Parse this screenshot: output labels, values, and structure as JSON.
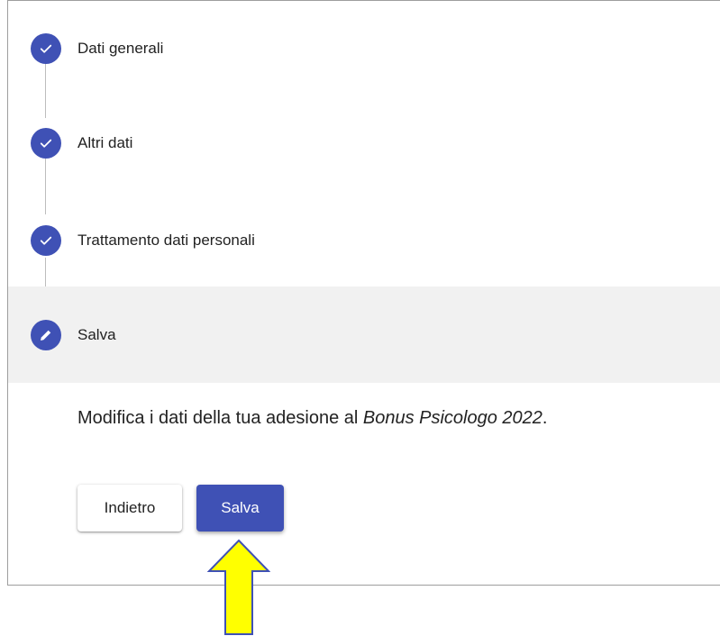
{
  "steps": [
    {
      "label": "Dati generali",
      "status": "completed",
      "icon": "check-icon"
    },
    {
      "label": "Altri dati",
      "status": "completed",
      "icon": "check-icon"
    },
    {
      "label": "Trattamento dati personali",
      "status": "completed",
      "icon": "check-icon"
    },
    {
      "label": "Salva",
      "status": "active",
      "icon": "pencil-icon"
    }
  ],
  "content": {
    "text_prefix": "Modifica i dati della tua adesione al ",
    "text_emphasis": "Bonus Psicologo 2022",
    "text_suffix": "."
  },
  "buttons": {
    "back_label": "Indietro",
    "save_label": "Salva"
  },
  "colors": {
    "accent": "#3f51b5",
    "active_step_bg": "#f1f1f1",
    "annotation_arrow": "#ffff00"
  }
}
